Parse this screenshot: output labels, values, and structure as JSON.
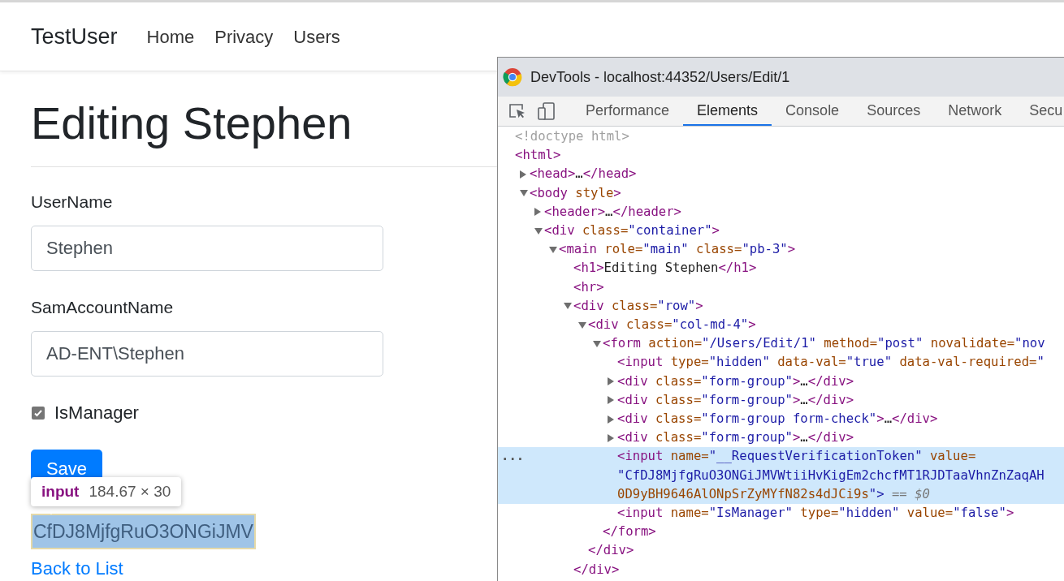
{
  "page": {
    "brand": "TestUser",
    "nav": [
      {
        "label": "Home"
      },
      {
        "label": "Privacy"
      },
      {
        "label": "Users"
      }
    ],
    "heading": "Editing Stephen",
    "fields": [
      {
        "label": "UserName",
        "value": "Stephen"
      },
      {
        "label": "SamAccountName",
        "value": "AD-ENT\\Stephen"
      }
    ],
    "checkbox": {
      "label": "IsManager",
      "checked": true
    },
    "save_button": "Save",
    "inspect_tooltip": {
      "tag": "input",
      "size": "184.67 × 30"
    },
    "highlighted_input": {
      "value": "CfDJ8MjfgRuO3ONGiJMV"
    },
    "back_link": "Back to List"
  },
  "devtools": {
    "title": "DevTools - localhost:44352/Users/Edit/1",
    "tabs": [
      {
        "label": "Performance",
        "selected": false
      },
      {
        "label": "Elements",
        "selected": true
      },
      {
        "label": "Console",
        "selected": false
      },
      {
        "label": "Sources",
        "selected": false
      },
      {
        "label": "Network",
        "selected": false
      },
      {
        "label": "Secu",
        "selected": false
      }
    ],
    "elements_tree": [
      {
        "kind": "doctype",
        "lines": [
          "<!doctype html>"
        ],
        "selected": false
      },
      {
        "kind": "element",
        "lines": [
          "<html>"
        ],
        "selected": false,
        "children": [
          {
            "kind": "element",
            "lines": [
              "<head>…</head>"
            ],
            "expanded": false,
            "selected": false
          },
          {
            "kind": "element",
            "lines": [
              "<body style>"
            ],
            "expanded": true,
            "selected": false,
            "children": [
              {
                "kind": "element",
                "lines": [
                  "<header>…</header>"
                ],
                "expanded": false,
                "selected": false
              },
              {
                "kind": "element",
                "lines": [
                  "<div class=\"container\">"
                ],
                "expanded": true,
                "selected": false,
                "children": [
                  {
                    "kind": "element",
                    "lines": [
                      "<main role=\"main\" class=\"pb-3\">"
                    ],
                    "expanded": true,
                    "selected": false,
                    "children": [
                      {
                        "kind": "element",
                        "lines": [
                          "<h1>Editing Stephen</h1>"
                        ],
                        "selected": false
                      },
                      {
                        "kind": "element",
                        "lines": [
                          "<hr>"
                        ],
                        "selected": false
                      },
                      {
                        "kind": "element",
                        "lines": [
                          "<div class=\"row\">"
                        ],
                        "expanded": true,
                        "selected": false,
                        "closing": "</div>",
                        "children": [
                          {
                            "kind": "element",
                            "lines": [
                              "<div class=\"col-md-4\">"
                            ],
                            "expanded": true,
                            "selected": false,
                            "closing": "</div>",
                            "children": [
                              {
                                "kind": "element",
                                "lines": [
                                  "<form action=\"/Users/Edit/1\" method=\"post\" novalidate=\"nov"
                                ],
                                "expanded": true,
                                "selected": false,
                                "closing": "</form>",
                                "children": [
                                  {
                                    "kind": "element",
                                    "lines": [
                                      "<input type=\"hidden\" data-val=\"true\" data-val-required=\""
                                    ],
                                    "selected": false
                                  },
                                  {
                                    "kind": "element",
                                    "lines": [
                                      "<div class=\"form-group\">…</div>"
                                    ],
                                    "expanded": false,
                                    "selected": false
                                  },
                                  {
                                    "kind": "element",
                                    "lines": [
                                      "<div class=\"form-group\">…</div>"
                                    ],
                                    "expanded": false,
                                    "selected": false
                                  },
                                  {
                                    "kind": "element",
                                    "lines": [
                                      "<div class=\"form-group form-check\">…</div>"
                                    ],
                                    "expanded": false,
                                    "selected": false
                                  },
                                  {
                                    "kind": "element",
                                    "lines": [
                                      "<div class=\"form-group\">…</div>"
                                    ],
                                    "expanded": false,
                                    "selected": false
                                  },
                                  {
                                    "kind": "element",
                                    "lines": [
                                      "<input name=\"__RequestVerificationToken\" value=",
                                      "\"CfDJ8MjfgRuO3ONGiJMVWtiiHvKigEm2chcfMT1RJDTaaVhnZnZaqAH",
                                      "0D9yBH9646AlONpSrZyMYfN82s4dJCi9s\">"
                                    ],
                                    "selected": true,
                                    "console_ref": "== $0",
                                    "more": "..."
                                  },
                                  {
                                    "kind": "element",
                                    "lines": [
                                      "<input name=\"IsManager\" type=\"hidden\" value=\"false\">"
                                    ],
                                    "selected": false
                                  }
                                ]
                              }
                            ]
                          }
                        ]
                      }
                    ]
                  }
                ]
              }
            ]
          }
        ]
      }
    ]
  }
}
